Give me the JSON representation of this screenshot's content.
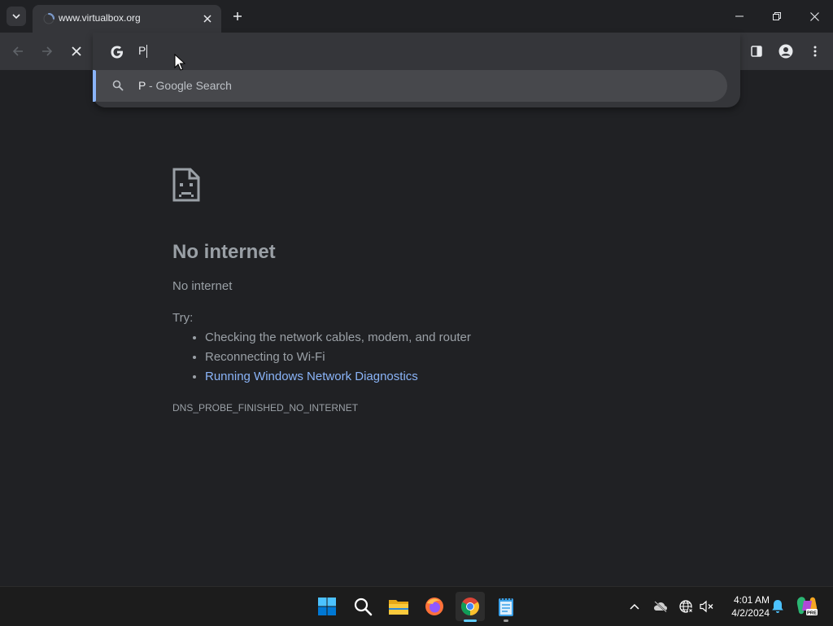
{
  "tab": {
    "title": "www.virtualbox.org"
  },
  "omnibox": {
    "typed": "P"
  },
  "suggestion": {
    "query": "P",
    "suffix": " - Google Search"
  },
  "error": {
    "title": "No internet",
    "subtitle": "No internet",
    "try_label": "Try:",
    "items": [
      "Checking the network cables, modem, and router",
      "Reconnecting to Wi-Fi"
    ],
    "link": "Running Windows Network Diagnostics",
    "code": "DNS_PROBE_FINISHED_NO_INTERNET"
  },
  "taskbar": {
    "time": "4:01 AM",
    "date": "4/2/2024",
    "apps": [
      "start-icon",
      "search-icon",
      "file-explorer-icon",
      "firefox-icon",
      "chrome-icon",
      "notepad-icon"
    ]
  },
  "colors": {
    "page_bg": "#202124",
    "toolbar_bg": "#35363a",
    "link": "#8ab4f8",
    "accent": "#60cdff"
  }
}
